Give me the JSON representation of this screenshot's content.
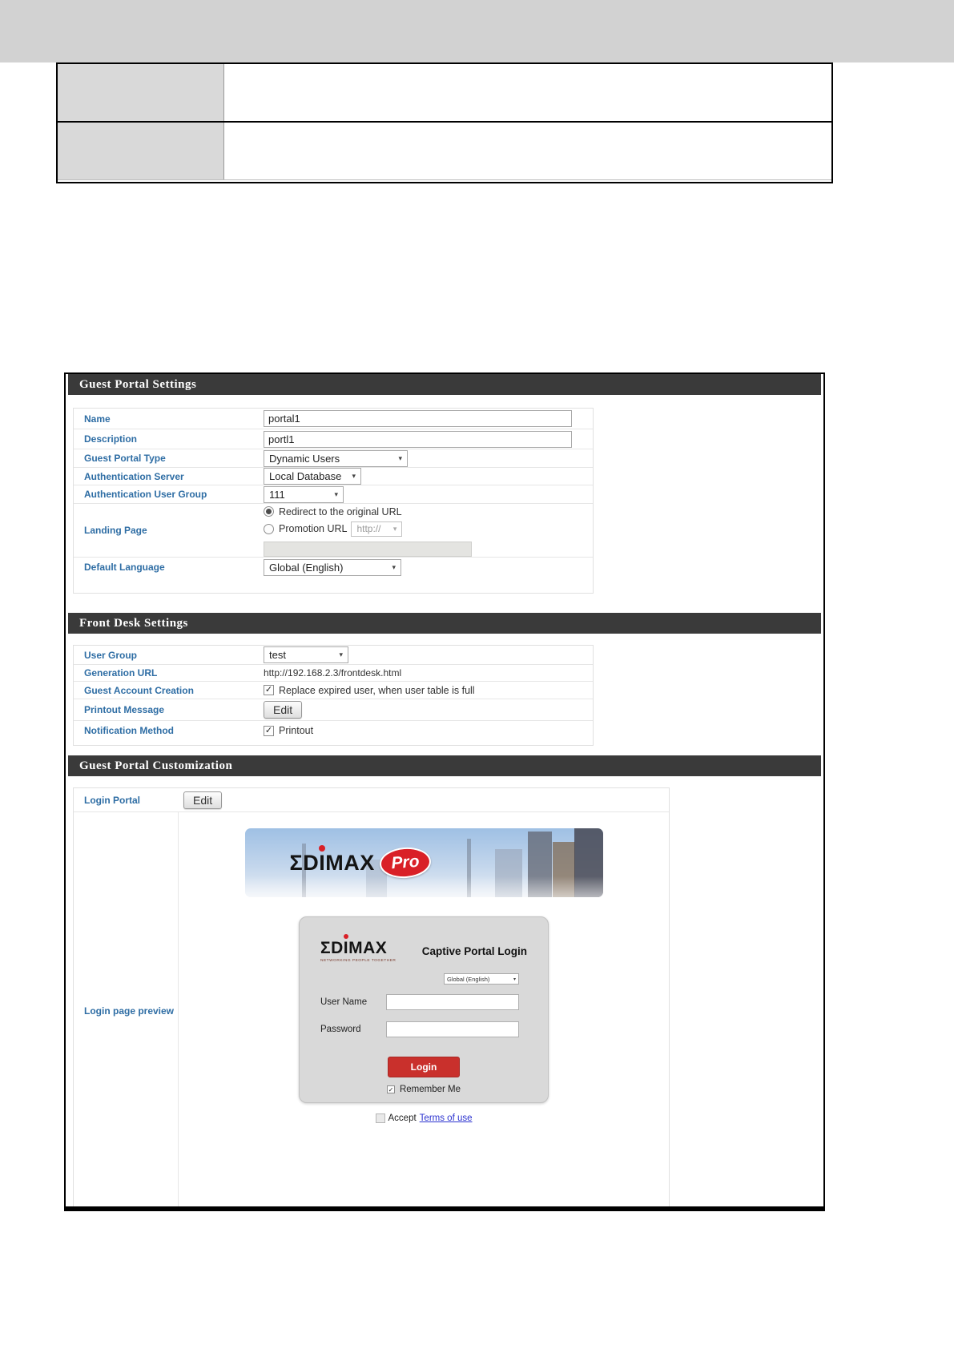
{
  "icons": {
    "check": "✓",
    "dropdown_arrow": "▾"
  },
  "colors": {
    "section_bar": "#3a3a3a",
    "label_blue": "#2e6da4",
    "edimax_red": "#d92027",
    "login_button_red": "#c9302c",
    "link_blue": "#2b32cf",
    "page_band_gray": "#d2d2d2"
  },
  "guest_portal_settings": {
    "title": "Guest Portal Settings",
    "name_label": "Name",
    "name_value": "portal1",
    "description_label": "Description",
    "description_value": "portl1",
    "type_label": "Guest Portal Type",
    "type_value": "Dynamic Users",
    "auth_server_label": "Authentication Server",
    "auth_server_value": "Local Database",
    "auth_group_label": "Authentication User Group",
    "auth_group_value": "111",
    "landing_label": "Landing Page",
    "landing_redirect_option": "Redirect to the original URL",
    "landing_promotion_option": "Promotion URL",
    "landing_promotion_scheme": "http://",
    "language_label": "Default Language",
    "language_value": "Global (English)"
  },
  "front_desk_settings": {
    "title": "Front Desk Settings",
    "user_group_label": "User Group",
    "user_group_value": "test",
    "generation_url_label": "Generation URL",
    "generation_url_value": "http://192.168.2.3/frontdesk.html",
    "guest_account_label": "Guest Account Creation",
    "guest_account_option": "Replace expired user, when user table is full",
    "printout_label": "Printout Message",
    "printout_button": "Edit",
    "notification_label": "Notification Method",
    "notification_option": "Printout"
  },
  "guest_portal_customization": {
    "title": "Guest Portal Customization",
    "login_portal_label": "Login Portal",
    "login_portal_button": "Edit",
    "preview_label": "Login page preview",
    "preview": {
      "brand_part1": "ΣD",
      "brand_i": "I",
      "brand_part2": "MAX",
      "brand_badge": "Pro",
      "card_tagline": "NETWORKING PEOPLE TOGETHER",
      "card_title": "Captive Portal Login",
      "language_value": "Global (English)",
      "username_label": "User Name",
      "password_label": "Password",
      "login_button": "Login",
      "remember_label": "Remember Me",
      "accept_label": "Accept",
      "terms_link": "Terms of use"
    }
  }
}
